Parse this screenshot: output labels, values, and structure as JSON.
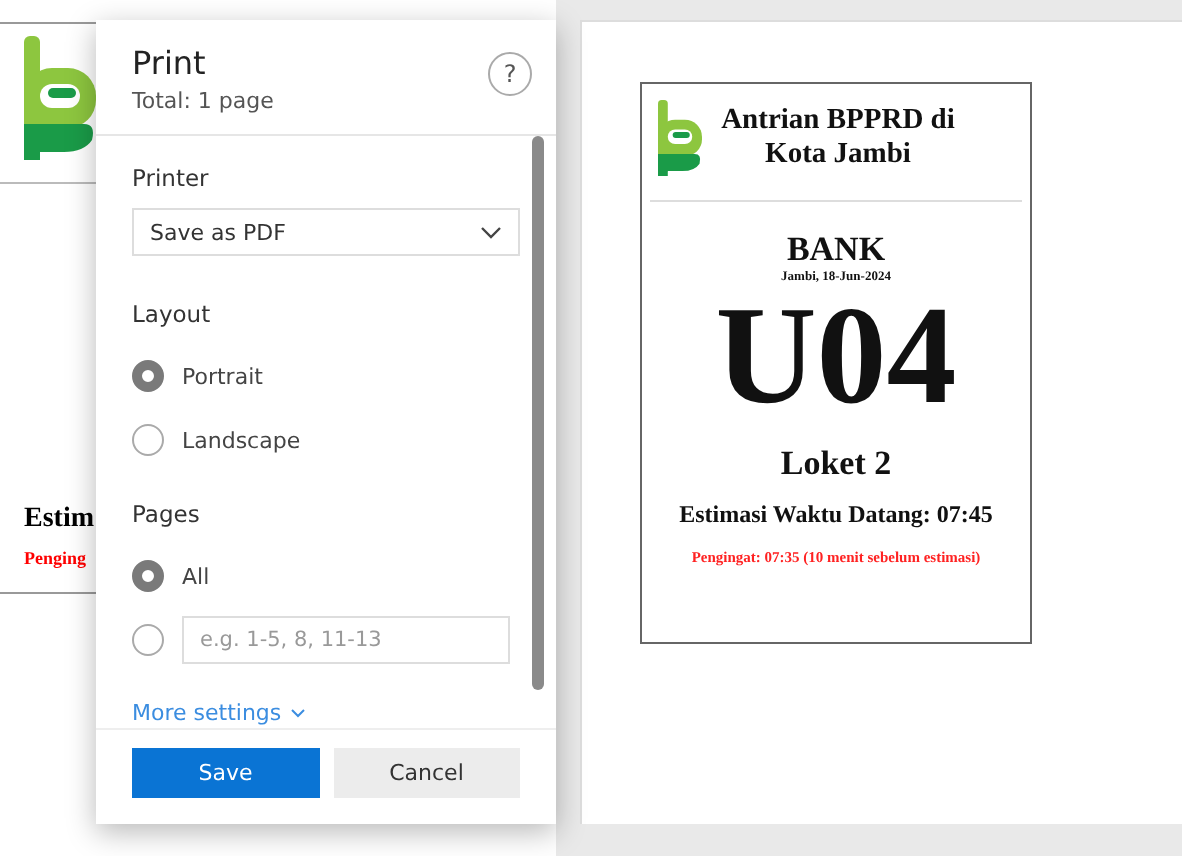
{
  "background_page": {
    "estimate_fragment": "Estim",
    "reminder_fragment": "Penging"
  },
  "dialog": {
    "title": "Print",
    "subtitle": "Total: 1 page",
    "help": "?",
    "printer": {
      "label": "Printer",
      "value": "Save as PDF"
    },
    "layout": {
      "label": "Layout",
      "options": [
        {
          "label": "Portrait",
          "selected": true
        },
        {
          "label": "Landscape",
          "selected": false
        }
      ]
    },
    "pages": {
      "label": "Pages",
      "options": [
        {
          "kind": "radio",
          "label": "All",
          "selected": true
        },
        {
          "kind": "range",
          "placeholder": "e.g. 1-5, 8, 11-13",
          "selected": false
        }
      ]
    },
    "more_settings": "More settings",
    "buttons": [
      {
        "label": "Save",
        "kind": "primary"
      },
      {
        "label": "Cancel",
        "kind": "secondary"
      }
    ]
  },
  "preview": {
    "ticket": {
      "title": "Antrian BPPRD di Kota Jambi",
      "service": "BANK",
      "date": "Jambi, 18-Jun-2024",
      "number": "U04",
      "counter": "Loket 2",
      "estimate": "Estimasi Waktu Datang: 07:45",
      "reminder": "Pengingat: 07:35 (10 menit sebelum estimasi)"
    }
  }
}
